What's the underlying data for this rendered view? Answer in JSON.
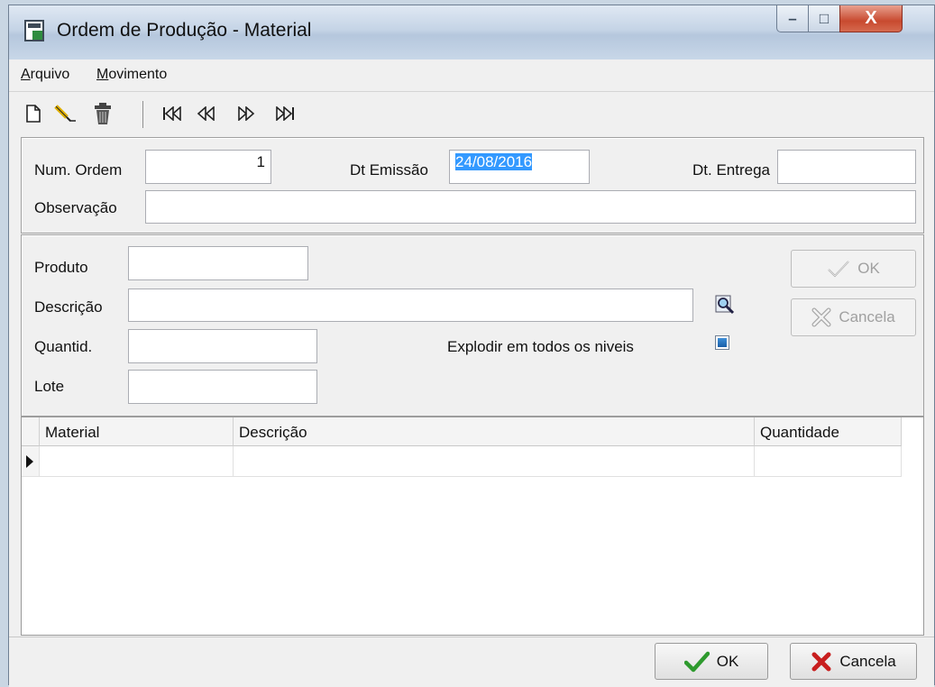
{
  "window": {
    "title": "Ordem de Produção - Material",
    "controls": {
      "minimize": "–",
      "maximize": "□",
      "close": "X"
    }
  },
  "menu": {
    "items": [
      {
        "label": "Arquivo"
      },
      {
        "label": "Movimento"
      }
    ]
  },
  "toolbar": {
    "icons": [
      "new-icon",
      "edit-icon",
      "delete-icon",
      "first-record-icon",
      "prev-record-icon",
      "next-record-icon",
      "last-record-icon"
    ]
  },
  "header": {
    "num_ordem_label": "Num. Ordem",
    "num_ordem_value": "1",
    "dt_emissao_label": "Dt Emissão",
    "dt_emissao_value": "24/08/2016",
    "dt_entrega_label": "Dt. Entrega",
    "dt_entrega_value": "",
    "observacao_label": "Observação",
    "observacao_value": ""
  },
  "item": {
    "produto_label": "Produto",
    "produto_value": "",
    "descricao_label": "Descrição",
    "descricao_value": "",
    "quantid_label": "Quantid.",
    "quantid_value": "",
    "lote_label": "Lote",
    "lote_value": "",
    "explodir_label": "Explodir em todos os niveis",
    "explodir_checked": true,
    "ok_label": "OK",
    "cancela_label": "Cancela"
  },
  "grid": {
    "columns": [
      "Material",
      "Descrição",
      "Quantidade"
    ],
    "rows": [
      [
        "",
        "",
        ""
      ]
    ]
  },
  "footer": {
    "ok_label": "OK",
    "cancela_label": "Cancela"
  },
  "colors": {
    "ok_check": "#2e9a2e",
    "cancel_x": "#c81e1e",
    "selection": "#3399ff"
  }
}
